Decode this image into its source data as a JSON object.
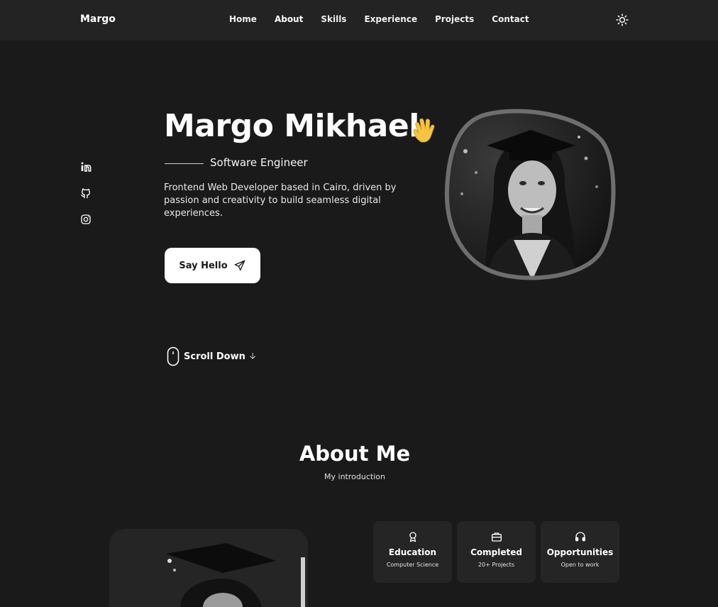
{
  "header": {
    "brand": "Margo",
    "nav": [
      "Home",
      "About",
      "Skills",
      "Experience",
      "Projects",
      "Contact"
    ],
    "active_nav": "About",
    "theme_icon": "sun-icon"
  },
  "socials": [
    {
      "icon": "linkedin-icon"
    },
    {
      "icon": "github-icon"
    },
    {
      "icon": "instagram-icon"
    }
  ],
  "hero": {
    "name": "Margo Mikhael",
    "wave_icon": "waving-hand-icon",
    "subtitle": "Software Engineer",
    "description": "Frontend Web Developer based in Cairo, driven by passion and creativity to build seamless digital experiences.",
    "cta_label": "Say Hello",
    "scroll_label": "Scroll Down",
    "scroll_arrow": "🡣"
  },
  "about": {
    "title": "About Me",
    "subtitle": "My introduction",
    "cards": [
      {
        "icon": "award-icon",
        "title": "Education",
        "subtitle": "Computer Science"
      },
      {
        "icon": "briefcase-icon",
        "title": "Completed",
        "subtitle": "20+ Projects"
      },
      {
        "icon": "headset-icon",
        "title": "Opportunities",
        "subtitle": "Open to work"
      }
    ]
  },
  "colors": {
    "background": "#1a1a1a",
    "header": "#232323",
    "card": "#252525",
    "accent": "#ffffff",
    "wave": "#f5c542"
  }
}
